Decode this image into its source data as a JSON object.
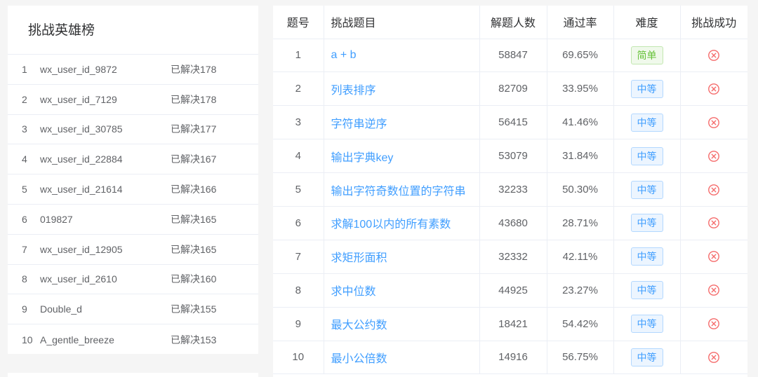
{
  "leaderboard": {
    "title": "挑战英雄榜",
    "items": [
      {
        "rank": "1",
        "name": "wx_user_id_9872",
        "solved": "已解决178"
      },
      {
        "rank": "2",
        "name": "wx_user_id_7129",
        "solved": "已解决178"
      },
      {
        "rank": "3",
        "name": "wx_user_id_30785",
        "solved": "已解决177"
      },
      {
        "rank": "4",
        "name": "wx_user_id_22884",
        "solved": "已解决167"
      },
      {
        "rank": "5",
        "name": "wx_user_id_21614",
        "solved": "已解决166"
      },
      {
        "rank": "6",
        "name": "019827",
        "solved": "已解决165"
      },
      {
        "rank": "7",
        "name": "wx_user_id_12905",
        "solved": "已解决165"
      },
      {
        "rank": "8",
        "name": "wx_user_id_2610",
        "solved": "已解决160"
      },
      {
        "rank": "9",
        "name": "Double_d",
        "solved": "已解决155"
      },
      {
        "rank": "10",
        "name": "A_gentle_breeze",
        "solved": "已解决153"
      }
    ]
  },
  "problems": {
    "headers": {
      "num": "题号",
      "title": "挑战题目",
      "solvers": "解题人数",
      "pass_rate": "通过率",
      "difficulty": "难度",
      "success": "挑战成功"
    },
    "rows": [
      {
        "num": "1",
        "title": "a + b",
        "solvers": "58847",
        "pass_rate": "69.65%",
        "difficulty": "简单",
        "level": "easy",
        "success_icon": "x-circle-icon"
      },
      {
        "num": "2",
        "title": "列表排序",
        "solvers": "82709",
        "pass_rate": "33.95%",
        "difficulty": "中等",
        "level": "mid",
        "success_icon": "x-circle-icon"
      },
      {
        "num": "3",
        "title": "字符串逆序",
        "solvers": "56415",
        "pass_rate": "41.46%",
        "difficulty": "中等",
        "level": "mid",
        "success_icon": "x-circle-icon"
      },
      {
        "num": "4",
        "title": "输出字典key",
        "solvers": "53079",
        "pass_rate": "31.84%",
        "difficulty": "中等",
        "level": "mid",
        "success_icon": "x-circle-icon"
      },
      {
        "num": "5",
        "title": "输出字符奇数位置的字符串",
        "solvers": "32233",
        "pass_rate": "50.30%",
        "difficulty": "中等",
        "level": "mid",
        "success_icon": "x-circle-icon"
      },
      {
        "num": "6",
        "title": "求解100以内的所有素数",
        "solvers": "43680",
        "pass_rate": "28.71%",
        "difficulty": "中等",
        "level": "mid",
        "success_icon": "x-circle-icon"
      },
      {
        "num": "7",
        "title": "求矩形面积",
        "solvers": "32332",
        "pass_rate": "42.11%",
        "difficulty": "中等",
        "level": "mid",
        "success_icon": "x-circle-icon"
      },
      {
        "num": "8",
        "title": "求中位数",
        "solvers": "44925",
        "pass_rate": "23.27%",
        "difficulty": "中等",
        "level": "mid",
        "success_icon": "x-circle-icon"
      },
      {
        "num": "9",
        "title": "最大公约数",
        "solvers": "18421",
        "pass_rate": "54.42%",
        "difficulty": "中等",
        "level": "mid",
        "success_icon": "x-circle-icon"
      },
      {
        "num": "10",
        "title": "最小公倍数",
        "solvers": "14916",
        "pass_rate": "56.75%",
        "difficulty": "中等",
        "level": "mid",
        "success_icon": "x-circle-icon"
      }
    ]
  },
  "colors": {
    "link": "#409eff",
    "easy": "#67c23a",
    "mid": "#409eff",
    "fail": "#f56c6c"
  }
}
